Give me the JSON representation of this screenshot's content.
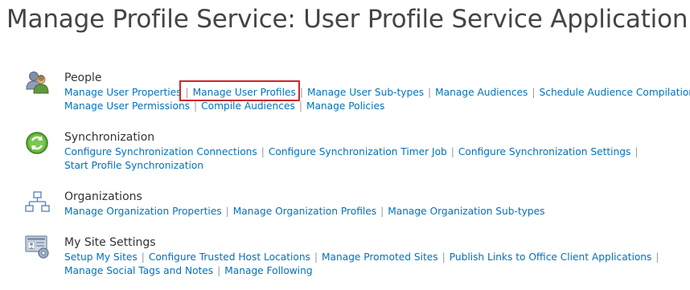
{
  "page": {
    "title": "Manage Profile Service: User Profile Service Application"
  },
  "sections": [
    {
      "heading": "People",
      "icon": "people-icon",
      "lines": [
        [
          "Manage User Properties",
          "Manage User Profiles",
          "Manage User Sub-types",
          "Manage Audiences",
          "Schedule Audience Compilation"
        ],
        [
          "Manage User Permissions",
          "Compile Audiences",
          "Manage Policies"
        ]
      ]
    },
    {
      "heading": "Synchronization",
      "icon": "sync-icon",
      "lines": [
        [
          "Configure Synchronization Connections",
          "Configure Synchronization Timer Job",
          "Configure Synchronization Settings"
        ],
        [
          "Start Profile Synchronization"
        ]
      ]
    },
    {
      "heading": "Organizations",
      "icon": "org-chart-icon",
      "lines": [
        [
          "Manage Organization Properties",
          "Manage Organization Profiles",
          "Manage Organization Sub-types"
        ]
      ]
    },
    {
      "heading": "My Site Settings",
      "icon": "my-site-icon",
      "lines": [
        [
          "Setup My Sites",
          "Configure Trusted Host Locations",
          "Manage Promoted Sites",
          "Publish Links to Office Client Applications"
        ],
        [
          "Manage Social Tags and Notes",
          "Manage Following"
        ]
      ]
    }
  ],
  "separator": "|",
  "highlighted_link": "Manage User Profiles",
  "colors": {
    "link": "#0072bc",
    "heading": "#333333",
    "title": "#444444",
    "highlight_border": "#d0262a"
  }
}
